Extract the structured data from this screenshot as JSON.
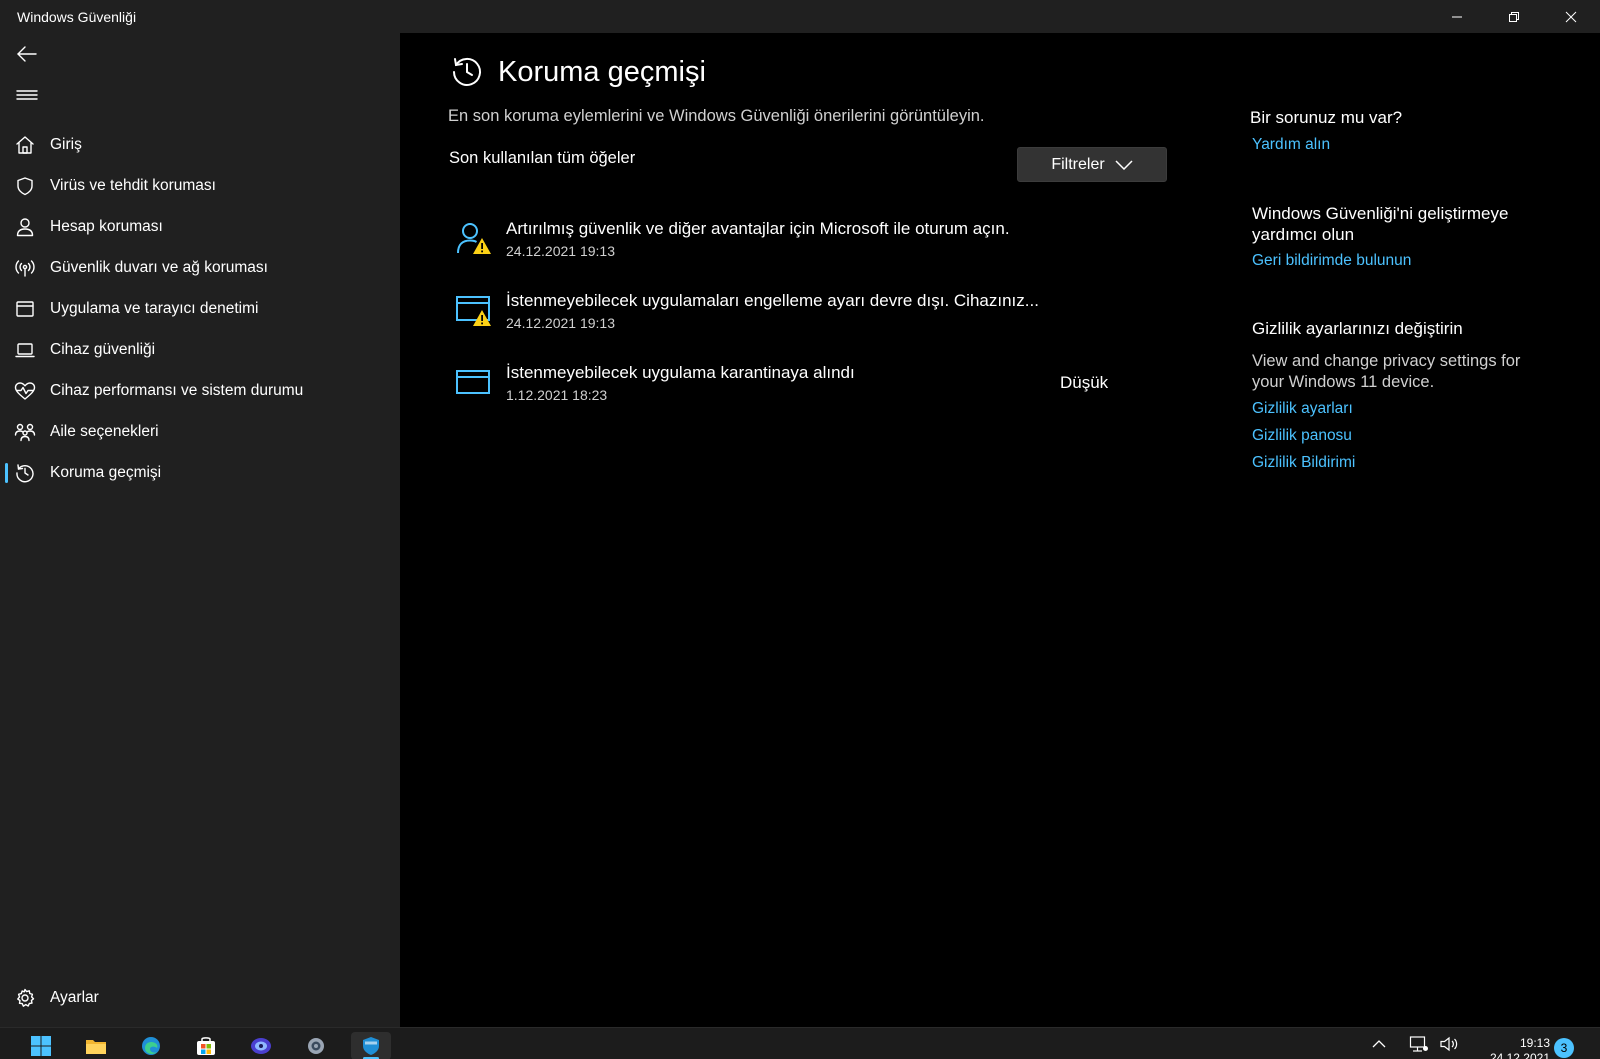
{
  "window": {
    "title": "Windows Güvenliği"
  },
  "sidebar": {
    "items": [
      {
        "label": "Giriş",
        "icon": "home-icon"
      },
      {
        "label": "Virüs ve tehdit koruması",
        "icon": "shield-icon"
      },
      {
        "label": "Hesap koruması",
        "icon": "person-icon"
      },
      {
        "label": "Güvenlik duvarı ve ağ koruması",
        "icon": "antenna-icon"
      },
      {
        "label": "Uygulama ve tarayıcı denetimi",
        "icon": "app-window-icon"
      },
      {
        "label": "Cihaz güvenliği",
        "icon": "laptop-icon"
      },
      {
        "label": "Cihaz performansı ve sistem durumu",
        "icon": "heart-pulse-icon"
      },
      {
        "label": "Aile seçenekleri",
        "icon": "family-icon"
      },
      {
        "label": "Koruma geçmişi",
        "icon": "history-icon",
        "active": true
      }
    ],
    "settings_label": "Ayarlar"
  },
  "main": {
    "title": "Koruma geçmişi",
    "subtitle": "En son koruma eylemlerini ve Windows Güvenliği önerilerini görüntüleyin.",
    "section_label": "Son kullanılan tüm öğeler",
    "filter_label": "Filtreler",
    "history": [
      {
        "title": "Artırılmış güvenlik ve diğer avantajlar için Microsoft ile oturum açın.",
        "date": "24.12.2021 19:13",
        "severity": "",
        "icon": "account-warning-icon"
      },
      {
        "title": "İstenmeyebilecek uygulamaları engelleme ayarı devre dışı. Cihazınız...",
        "date": "24.12.2021 19:13",
        "severity": "",
        "icon": "app-warning-icon"
      },
      {
        "title": "İstenmeyebilecek uygulama karantinaya alındı",
        "date": "1.12.2021 18:23",
        "severity": "Düşük",
        "icon": "app-window-icon"
      }
    ]
  },
  "aside": {
    "help_heading": "Bir sorunuz mu var?",
    "help_link": "Yardım alın",
    "improve_heading_1": "Windows Güvenliği'ni geliştirmeye",
    "improve_heading_2": "yardımcı olun",
    "improve_link": "Geri bildirimde bulunun",
    "privacy_heading": "Gizlilik ayarlarınızı değiştirin",
    "privacy_text": "View and change privacy settings for your Windows 11 device.",
    "privacy_links": [
      "Gizlilik ayarları",
      "Gizlilik panosu",
      "Gizlilik Bildirimi"
    ]
  },
  "taskbar": {
    "apps": [
      "start-icon",
      "file-explorer-icon",
      "edge-icon",
      "store-icon",
      "media-icon",
      "settings-icon",
      "security-icon"
    ],
    "clock_time": "19:13",
    "clock_date": "24.12.2021",
    "notification_count": "3"
  },
  "colors": {
    "accent": "#4cc2ff",
    "warning": "#fcd116",
    "sidebar_bg": "#202020",
    "main_bg": "#000000"
  }
}
